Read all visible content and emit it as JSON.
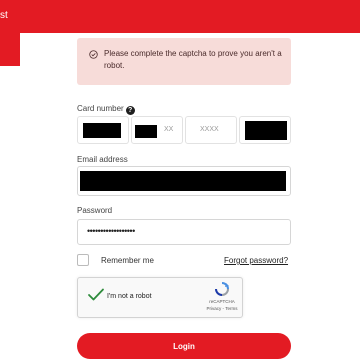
{
  "header": {
    "partial_text": "st",
    "brand_color": "#e31b23"
  },
  "alert": {
    "icon": "check-circle-icon",
    "message": "Please complete the captcha to prove you aren't a robot."
  },
  "card_number": {
    "label": "Card number",
    "info_icon_glyph": "?",
    "segment2_placeholder": "XX",
    "segment3_placeholder": "XXXX"
  },
  "email": {
    "label": "Email address"
  },
  "password": {
    "label": "Password",
    "masked_value": "••••••••••••••••••"
  },
  "remember": {
    "label": "Remember me",
    "checked": false
  },
  "forgot": {
    "label": "Forgot password?"
  },
  "captcha": {
    "label": "I'm not a robot",
    "brand": "reCAPTCHA",
    "links": "Privacy - Terms",
    "checked": true,
    "check_color": "#2e8b3c"
  },
  "login": {
    "label": "Login"
  }
}
